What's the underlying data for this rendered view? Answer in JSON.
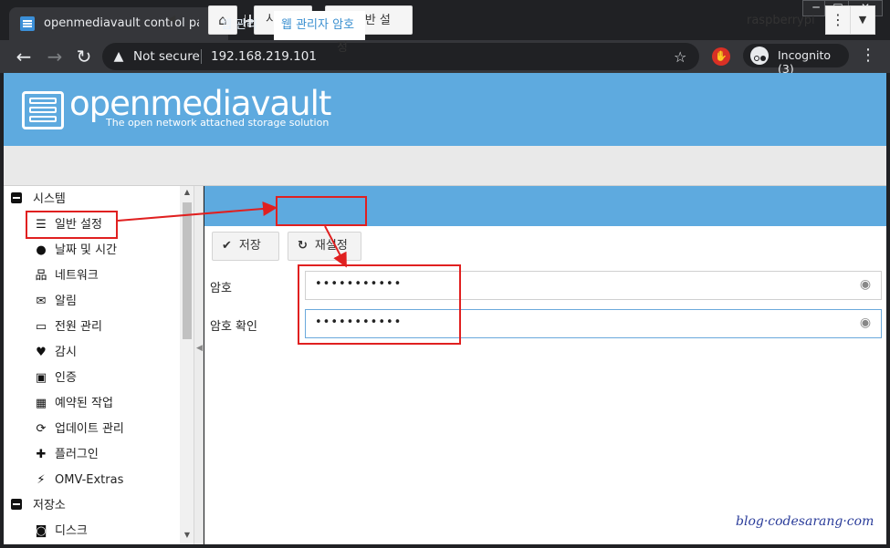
{
  "browser": {
    "tab_title": "openmediavault control panel - r",
    "tab_close": "✕",
    "new_tab": "+",
    "window_min": "─",
    "window_max": "□",
    "window_close": "✕",
    "security_label": "Not secure",
    "url": "192.168.219.101",
    "profile_label": "Incognito (3)"
  },
  "header": {
    "title": "openmediavault",
    "subtitle": "The open network attached storage solution"
  },
  "toolbar": {
    "crumb_system": "시스템",
    "crumb_general": "일반 설정",
    "hostname": "raspberrypi"
  },
  "sidebar": {
    "groups": [
      {
        "label": "시스템"
      },
      {
        "label": "저장소"
      }
    ],
    "items": [
      {
        "label": "일반 설정",
        "icon": "sliders-icon"
      },
      {
        "label": "날짜 및 시간",
        "icon": "clock-icon"
      },
      {
        "label": "네트워크",
        "icon": "network-icon"
      },
      {
        "label": "알림",
        "icon": "envelope-icon"
      },
      {
        "label": "전원 관리",
        "icon": "battery-icon"
      },
      {
        "label": "감시",
        "icon": "heartbeat-icon"
      },
      {
        "label": "인증",
        "icon": "certificate-icon"
      },
      {
        "label": "예약된 작업",
        "icon": "calendar-clock-icon"
      },
      {
        "label": "업데이트 관리",
        "icon": "sync-icon"
      },
      {
        "label": "플러그인",
        "icon": "puzzle-icon"
      },
      {
        "label": "OMV-Extras",
        "icon": "plug-icon"
      },
      {
        "label": "디스크",
        "icon": "disk-icon"
      }
    ]
  },
  "main": {
    "tabs": [
      {
        "label": "웹 관리"
      },
      {
        "label": "웹 관리자 암호"
      }
    ],
    "buttons": {
      "save": "저장",
      "reset": "재설정"
    },
    "fields": {
      "password_label": "암호",
      "password_value": "•••••••••••",
      "confirm_label": "암호 확인",
      "confirm_value": "•••••••••••"
    }
  },
  "watermark": "blog·codesarang·com",
  "colors": {
    "header_blue": "#5eaadf",
    "annotation_red": "#e02020",
    "active_tab_text": "#3a8fd0"
  }
}
